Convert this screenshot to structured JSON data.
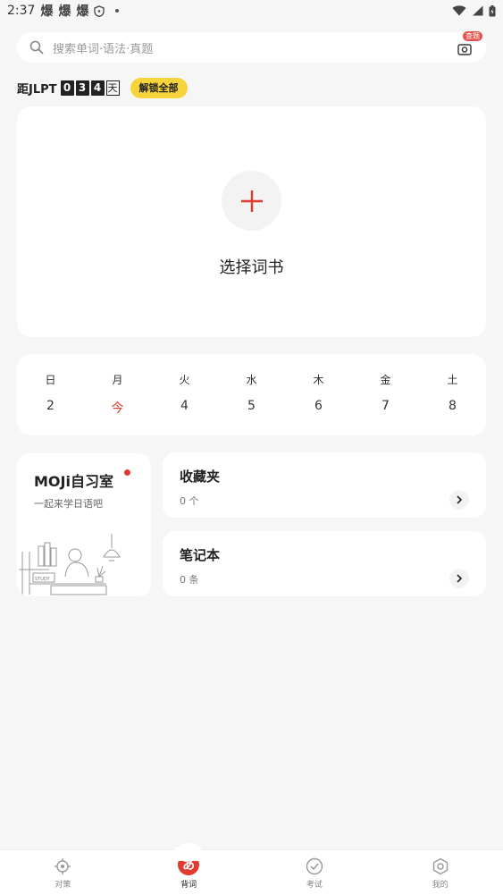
{
  "status_bar": {
    "time": "2:37",
    "glyphs": [
      "爆",
      "爆",
      "爆"
    ]
  },
  "search": {
    "placeholder": "搜索单词·语法·真题",
    "scan_badge": "查题"
  },
  "countdown": {
    "label": "距JLPT",
    "digits": [
      "0",
      "3",
      "4"
    ],
    "unit": "天",
    "unlock_label": "解锁全部"
  },
  "book_card": {
    "select_label": "选择词书"
  },
  "week": {
    "days": [
      "日",
      "月",
      "火",
      "水",
      "木",
      "金",
      "土"
    ],
    "dates": [
      "2",
      "今",
      "4",
      "5",
      "6",
      "7",
      "8"
    ],
    "today_index": 1
  },
  "study_room": {
    "title": "MOJi自习室",
    "subtitle": "一起来学日语吧",
    "illustration_text": "STUDY"
  },
  "favorites": {
    "title": "收藏夹",
    "count": "0 个"
  },
  "notebook": {
    "title": "笔记本",
    "count": "0 条"
  },
  "bottom_nav": {
    "items": [
      {
        "label": "对策",
        "icon": "target-icon"
      },
      {
        "label": "背词",
        "icon": "kana-a-icon",
        "glyph": "あ"
      },
      {
        "label": "考试",
        "icon": "check-circle-icon"
      },
      {
        "label": "我的",
        "icon": "profile-hex-icon"
      }
    ],
    "active_index": 1
  },
  "colors": {
    "accent": "#e03b2e",
    "unlock_yellow": "#f7d33c",
    "background": "#f6f6f6"
  }
}
